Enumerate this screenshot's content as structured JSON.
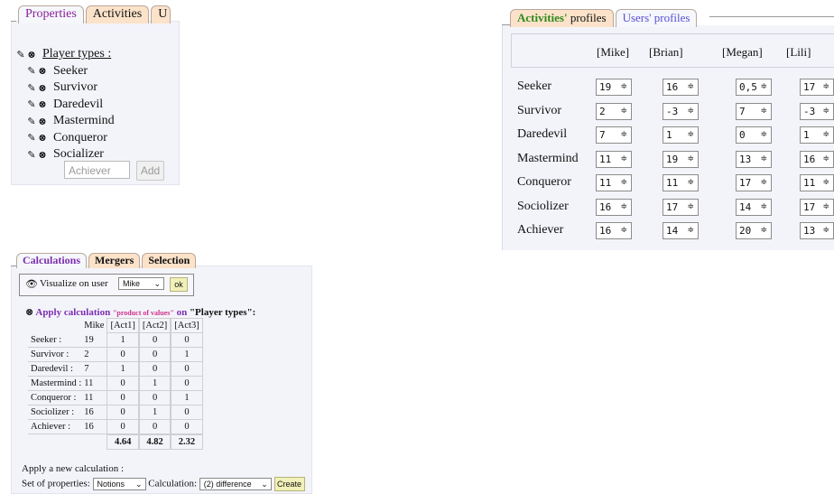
{
  "properties_panel": {
    "tabs": [
      "Properties",
      "Activities",
      "U"
    ],
    "root_label": "Player types :",
    "items": [
      "Seeker",
      "Survivor",
      "Daredevil",
      "Mastermind",
      "Conqueror",
      "Socializer"
    ],
    "add_placeholder": "Achiever",
    "add_button": "Add"
  },
  "profiles_panel": {
    "tabs": [
      {
        "label_colored": "Activities'",
        "label_rest": " profiles",
        "color": "#2e8b1e"
      },
      {
        "label_colored": "Users'",
        "label_rest": " profiles",
        "color": "#5b4fd6"
      }
    ],
    "users": [
      "[Mike]",
      "[Brian]",
      "[Megan]",
      "[Lili]"
    ],
    "rows": [
      {
        "label": "Seeker",
        "values": [
          "19",
          "16",
          "0,5",
          "17"
        ]
      },
      {
        "label": "Survivor",
        "values": [
          "2",
          "-3",
          "7",
          "-3"
        ]
      },
      {
        "label": "Daredevil",
        "values": [
          "7",
          "1",
          "0",
          "1"
        ]
      },
      {
        "label": "Mastermind",
        "values": [
          "11",
          "19",
          "13",
          "16"
        ]
      },
      {
        "label": "Conqueror",
        "values": [
          "11",
          "11",
          "17",
          "11"
        ]
      },
      {
        "label": "Sociolizer",
        "values": [
          "16",
          "17",
          "14",
          "17"
        ]
      },
      {
        "label": "Achiever",
        "values": [
          "16",
          "14",
          "20",
          "13"
        ]
      }
    ],
    "spinner_glyph": "≑"
  },
  "calc_panel": {
    "tabs": [
      "Calculations",
      "Mergers",
      "Selection"
    ],
    "visualize_label": "Visualize on user",
    "visualize_user": "Mike",
    "ok_label": "ok",
    "apply_prefix": "Apply calculation",
    "calc_name": "\"product of values\"",
    "on_text": "on",
    "target": "\"Player types\":",
    "columns": [
      "Mike",
      "[Act1]",
      "[Act2]",
      "[Act3]"
    ],
    "rows": [
      {
        "label": "Seeker :",
        "values": [
          "19",
          "1",
          "0",
          "0"
        ]
      },
      {
        "label": "Survivor :",
        "values": [
          "2",
          "0",
          "0",
          "1"
        ]
      },
      {
        "label": "Daredevil :",
        "values": [
          "7",
          "1",
          "0",
          "0"
        ]
      },
      {
        "label": "Mastermind :",
        "values": [
          "11",
          "0",
          "1",
          "0"
        ]
      },
      {
        "label": "Conqueror :",
        "values": [
          "11",
          "0",
          "0",
          "1"
        ]
      },
      {
        "label": "Sociolizer :",
        "values": [
          "16",
          "0",
          "1",
          "0"
        ]
      },
      {
        "label": "Achiever :",
        "values": [
          "16",
          "0",
          "0",
          "0"
        ]
      }
    ],
    "totals": [
      "4.64",
      "4.82",
      "2.32"
    ],
    "apply_new": "Apply a new calculation :",
    "set_label": "Set of properties:",
    "set_value": "Notions",
    "calc_label": "Calculation:",
    "calc_value": "(2) difference",
    "create_label": "Create"
  }
}
